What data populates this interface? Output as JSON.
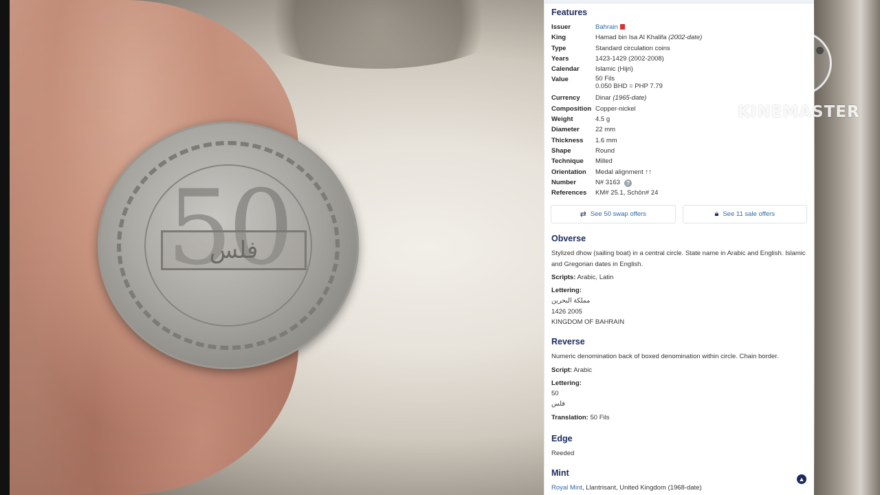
{
  "features": {
    "title": "Features",
    "rows": [
      {
        "key": "Issuer",
        "value": "Bahrain"
      },
      {
        "key": "King",
        "value": "Hamad bin Isa Al Khalifa",
        "extra": "(2002-date)"
      },
      {
        "key": "Type",
        "value": "Standard circulation coins"
      },
      {
        "key": "Years",
        "value": "1423-1429 (2002-2008)"
      },
      {
        "key": "Calendar",
        "value": "Islamic (Hijri)"
      },
      {
        "key": "Value",
        "value": "50 Fils",
        "value2": "0.050 BHD = PHP 7.79"
      },
      {
        "key": "Currency",
        "value": "Dinar",
        "extra": "(1965-date)"
      },
      {
        "key": "Composition",
        "value": "Copper-nickel"
      },
      {
        "key": "Weight",
        "value": "4.5 g"
      },
      {
        "key": "Diameter",
        "value": "22 mm"
      },
      {
        "key": "Thickness",
        "value": "1.6 mm"
      },
      {
        "key": "Shape",
        "value": "Round"
      },
      {
        "key": "Technique",
        "value": "Milled"
      },
      {
        "key": "Orientation",
        "value": "Medal alignment ↑↑"
      },
      {
        "key": "Number",
        "value": "N# 3163"
      },
      {
        "key": "References",
        "value": "KM# 25.1, Schön# 24"
      }
    ]
  },
  "offers": {
    "swap": "See 50 swap offers",
    "sale": "See 11 sale offers"
  },
  "obverse": {
    "title": "Obverse",
    "description": "Stylized dhow (sailing boat) in a central circle. State name in Arabic and English. Islamic and Gregorian dates in English.",
    "scripts_label": "Scripts:",
    "scripts": "Arabic, Latin",
    "lettering_label": "Lettering:",
    "lettering": [
      "مملكة البحرين",
      "1426 2005",
      "KINGDOM OF BAHRAIN"
    ]
  },
  "reverse": {
    "title": "Reverse",
    "description": "Numeric denomination back of boxed denomination within circle. Chain border.",
    "script_label": "Script:",
    "script": "Arabic",
    "lettering_label": "Lettering:",
    "lettering": [
      "50",
      "فلس"
    ],
    "translation_label": "Translation:",
    "translation": "50 Fils"
  },
  "edge": {
    "title": "Edge",
    "value": "Reeded"
  },
  "mint": {
    "title": "Mint",
    "link": "Royal Mint",
    "rest": ", Llantrisant, United Kingdom (1968-date)"
  },
  "coin_photo": {
    "number": "50",
    "word": "فلس"
  },
  "watermark": {
    "logo": "K",
    "text": "KINEMASTER"
  },
  "colors": {
    "heading": "#1b2a5e",
    "link": "#2f67a8"
  }
}
